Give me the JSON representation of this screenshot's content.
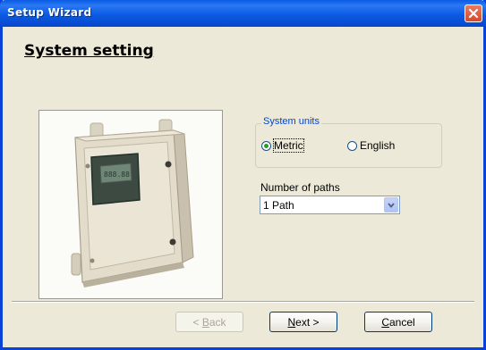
{
  "window": {
    "title": "Setup Wizard",
    "title_bar_color": "#0a5ae6",
    "close_icon": "close-icon"
  },
  "page": {
    "title": "System setting"
  },
  "illustration": {
    "description_icon": "device-enclosure-image",
    "display_text": "888.88"
  },
  "system_units": {
    "label": "System units",
    "options": [
      {
        "label": "Metric",
        "selected": true
      },
      {
        "label": "English",
        "selected": false
      }
    ]
  },
  "paths": {
    "label": "Number of paths",
    "selected_value": "1 Path"
  },
  "buttons": {
    "back": {
      "prefix": "< ",
      "accel": "B",
      "rest": "ack",
      "enabled": false
    },
    "next": {
      "accel": "N",
      "rest": "ext >",
      "enabled": true
    },
    "cancel": {
      "accel": "C",
      "rest": "ancel",
      "enabled": true
    }
  }
}
